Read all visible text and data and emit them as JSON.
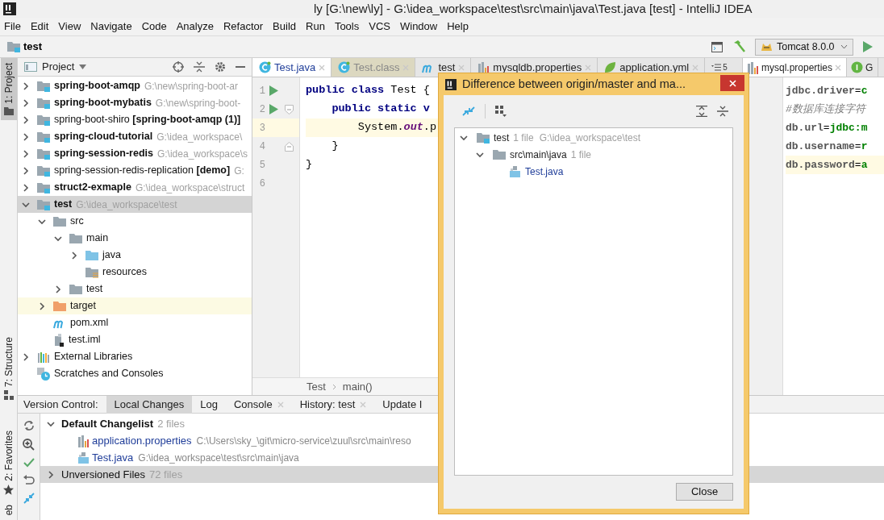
{
  "title_bar": {
    "title": "ly [G:\\new\\ly] - G:\\idea_workspace\\test\\src\\main\\java\\Test.java [test] - IntelliJ IDEA"
  },
  "menu": [
    "File",
    "Edit",
    "View",
    "Navigate",
    "Code",
    "Analyze",
    "Refactor",
    "Build",
    "Run",
    "Tools",
    "VCS",
    "Window",
    "Help"
  ],
  "nav_bar": {
    "breadcrumb": "test",
    "run_config": "Tomcat 8.0.0"
  },
  "side_tabs": [
    {
      "label": "1: Project",
      "kind": "project",
      "selected": true
    },
    {
      "label": "7: Structure",
      "kind": "structure",
      "selected": false
    },
    {
      "label": "2: Favorites",
      "kind": "favorites",
      "selected": false
    },
    {
      "label": "eb",
      "kind": "web",
      "selected": false
    }
  ],
  "project_panel": {
    "title": "Project",
    "tree": [
      {
        "label": "spring-boot-amqp",
        "bold": true,
        "path": "G:\\new\\spring-boot-ar",
        "kind": "module",
        "expanded": false,
        "selected": false,
        "highlighted": false
      },
      {
        "label": "spring-boot-mybatis",
        "bold": true,
        "path": "G:\\new\\spring-boot-",
        "kind": "module",
        "expanded": false,
        "selected": false,
        "highlighted": false
      },
      {
        "label": "spring-boot-shiro **[spring-boot-amqp (1)]**",
        "bold": false,
        "kind": "module",
        "expanded": false,
        "selected": false,
        "highlighted": false
      },
      {
        "label": "spring-cloud-tutorial",
        "bold": true,
        "path": "G:\\idea_workspace\\",
        "kind": "module",
        "expanded": false,
        "selected": false,
        "highlighted": false
      },
      {
        "label": "spring-session-redis",
        "bold": true,
        "path": "G:\\idea_workspace\\s",
        "kind": "module",
        "expanded": false,
        "selected": false,
        "highlighted": false
      },
      {
        "label": "spring-session-redis-replication **[demo]**",
        "bold": false,
        "path": "G:",
        "kind": "module",
        "expanded": false,
        "selected": false,
        "highlighted": false
      },
      {
        "label": "struct2-exmaple",
        "bold": true,
        "path": "G:\\idea_workspace\\struct",
        "kind": "module",
        "expanded": false,
        "selected": false,
        "highlighted": false
      },
      {
        "label": "test",
        "bold": true,
        "path": "G:\\idea_workspace\\test",
        "kind": "module",
        "expanded": true,
        "selected": true,
        "highlighted": false,
        "children": [
          {
            "label": "src",
            "bold": false,
            "kind": "folder",
            "expanded": true,
            "selected": false,
            "highlighted": false,
            "children": [
              {
                "label": "main",
                "bold": false,
                "kind": "folder",
                "expanded": true,
                "selected": false,
                "highlighted": false,
                "children": [
                  {
                    "label": "java",
                    "bold": false,
                    "kind": "source",
                    "expanded": false,
                    "selected": false,
                    "highlighted": false
                  },
                  {
                    "label": "resources",
                    "bold": false,
                    "kind": "resources",
                    "selected": false,
                    "highlighted": false
                  }
                ]
              },
              {
                "label": "test",
                "bold": false,
                "kind": "folder",
                "expanded": false,
                "selected": false,
                "highlighted": false
              }
            ]
          },
          {
            "label": "target",
            "bold": false,
            "kind": "excluded",
            "expanded": false,
            "selected": false,
            "highlighted": true
          },
          {
            "label": "pom.xml",
            "bold": false,
            "kind": "maven",
            "selected": false,
            "highlighted": false
          },
          {
            "label": "test.iml",
            "bold": false,
            "kind": "iml",
            "selected": false,
            "highlighted": false
          }
        ]
      },
      {
        "label": "External Libraries",
        "bold": false,
        "kind": "libraries",
        "expanded": false,
        "selected": false,
        "highlighted": false
      },
      {
        "label": "Scratches and Consoles",
        "bold": false,
        "kind": "scratches",
        "selected": false,
        "highlighted": false
      }
    ]
  },
  "editor": {
    "tabs": [
      {
        "label": "Test.java",
        "kind": "class",
        "selected": true,
        "external": false
      },
      {
        "label": "Test.class",
        "kind": "class",
        "selected": false,
        "external": true
      },
      {
        "label": "test",
        "kind": "maven",
        "selected": false,
        "external": false
      },
      {
        "label": "mysqldb.properties",
        "kind": "properties",
        "selected": false,
        "external": false
      },
      {
        "label": "application.yml",
        "kind": "yaml",
        "selected": false,
        "external": false
      }
    ],
    "overflow": "5",
    "lines": [
      {
        "number": "1",
        "run": true,
        "fold_start": false,
        "fold_end": false,
        "current": false,
        "tokens": [
          {
            "text": "public class",
            "kind": "keyword"
          },
          {
            "text": " Test {",
            "kind": "plain"
          }
        ]
      },
      {
        "number": "2",
        "run": true,
        "fold_start": true,
        "fold_end": false,
        "current": false,
        "tokens": [
          {
            "text": "    public static v",
            "kind": "keyword"
          }
        ]
      },
      {
        "number": "3",
        "run": false,
        "fold_start": false,
        "fold_end": false,
        "current": true,
        "tokens": [
          {
            "text": "        System.",
            "kind": "plain"
          },
          {
            "text": "out",
            "kind": "field"
          },
          {
            "text": ".p",
            "kind": "plain"
          }
        ]
      },
      {
        "number": "4",
        "run": false,
        "fold_start": false,
        "fold_end": true,
        "current": false,
        "tokens": [
          {
            "text": "    }",
            "kind": "plain"
          }
        ]
      },
      {
        "number": "5",
        "run": false,
        "fold_start": false,
        "fold_end": false,
        "current": false,
        "tokens": [
          {
            "text": "}",
            "kind": "plain"
          }
        ]
      },
      {
        "number": "6",
        "run": false,
        "fold_start": false,
        "fold_end": false,
        "current": false
      }
    ],
    "breadcrumbs": [
      "Test",
      "main()"
    ]
  },
  "split_editor": {
    "tabs": [
      {
        "label": "mysql.properties",
        "kind": "properties",
        "selected": true
      },
      {
        "label": "G",
        "kind": "interface",
        "selected": false
      }
    ],
    "lines": [
      {
        "current": false,
        "tokens": [
          {
            "text": "jdbc.driver",
            "kind": "key"
          },
          {
            "text": "=",
            "kind": "plain"
          },
          {
            "text": "c",
            "kind": "value"
          }
        ]
      },
      {
        "current": false,
        "tokens": [
          {
            "text": "#数据库连接字符",
            "kind": "comment"
          }
        ]
      },
      {
        "current": false,
        "tokens": [
          {
            "text": "db.url",
            "kind": "key"
          },
          {
            "text": "=",
            "kind": "plain"
          },
          {
            "text": "jdbc:m",
            "kind": "value"
          }
        ]
      },
      {
        "current": false,
        "tokens": [
          {
            "text": "db.username",
            "kind": "key"
          },
          {
            "text": "=",
            "kind": "plain"
          },
          {
            "text": "r",
            "kind": "value"
          }
        ]
      },
      {
        "current": true,
        "tokens": [
          {
            "text": "db.password",
            "kind": "key"
          },
          {
            "text": "=",
            "kind": "plain"
          },
          {
            "text": "a",
            "kind": "value"
          }
        ]
      }
    ]
  },
  "version_control": {
    "title": "Version Control:",
    "tabs": [
      {
        "label": "Local Changes",
        "selected": true,
        "closable": false
      },
      {
        "label": "Log",
        "selected": false,
        "closable": false
      },
      {
        "label": "Console",
        "selected": false,
        "closable": true
      },
      {
        "label": "History: test",
        "selected": false,
        "closable": true
      },
      {
        "label": "Update I",
        "selected": false,
        "closable": false
      }
    ],
    "changelists": [
      {
        "name": "Default Changelist",
        "count": "2 files",
        "default": true,
        "expanded": true,
        "selected": false,
        "files": [
          {
            "name": "application.properties",
            "path": "C:\\Users\\sky_\\git\\micro-service\\zuul\\src\\main\\reso",
            "kind": "properties"
          },
          {
            "name": "Test.java",
            "path": "G:\\idea_workspace\\test\\src\\main\\java",
            "kind": "java"
          }
        ]
      },
      {
        "name": "Unversioned Files",
        "count": "72 files",
        "default": false,
        "expanded": false,
        "selected": true
      }
    ]
  },
  "dialog": {
    "title": "Difference between origin/master and ma...",
    "tree": [
      {
        "label": "test",
        "count": "1 file",
        "path": "G:\\idea_workspace\\test",
        "kind": "module",
        "expanded": true,
        "children": [
          {
            "label": "src\\main\\java",
            "count": "1 file",
            "kind": "folder",
            "expanded": true,
            "children": [
              {
                "label": "Test.java",
                "kind": "java"
              }
            ]
          }
        ]
      }
    ],
    "button": "Close"
  }
}
